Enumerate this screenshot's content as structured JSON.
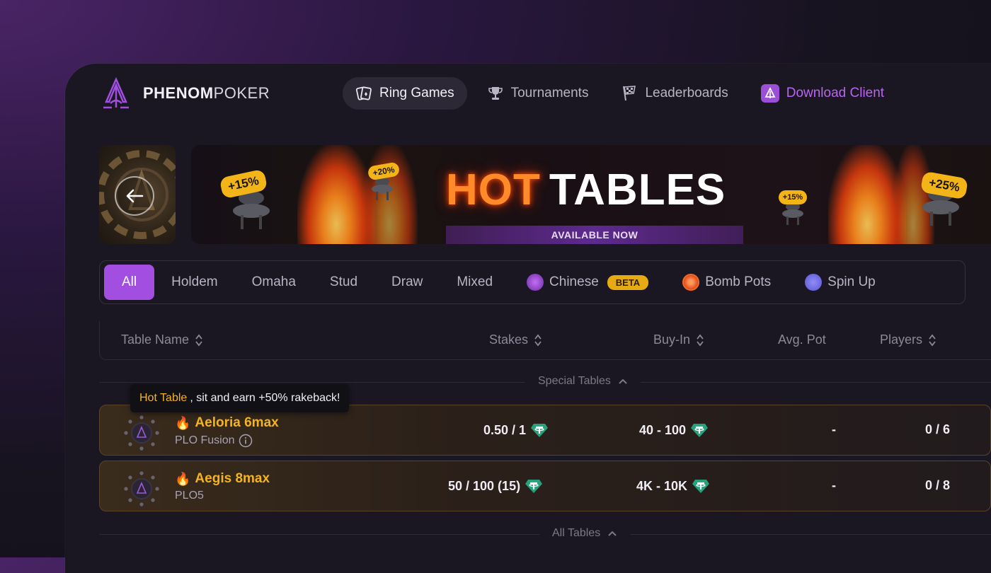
{
  "brand": {
    "name_bold": "PHENOM",
    "name_light": "POKER"
  },
  "nav": {
    "items": [
      {
        "label": "Ring Games",
        "icon": "cards-icon",
        "active": true
      },
      {
        "label": "Tournaments",
        "icon": "trophy-icon"
      },
      {
        "label": "Leaderboards",
        "icon": "flag-icon"
      },
      {
        "label": "Download Client",
        "icon": "download-client-icon"
      }
    ]
  },
  "banner": {
    "title_hot": "HOT",
    "title_tables": "TABLES",
    "subtitle": "AVAILABLE NOW",
    "badges": [
      "+15%",
      "+20%",
      "+15%",
      "+25%"
    ]
  },
  "filters": {
    "items": [
      "All",
      "Holdem",
      "Omaha",
      "Stud",
      "Draw",
      "Mixed",
      "Chinese",
      "Bomb Pots",
      "Spin Up"
    ],
    "beta_label": "BETA",
    "active": "All"
  },
  "table": {
    "headers": {
      "name": "Table Name",
      "stakes": "Stakes",
      "buyin": "Buy-In",
      "avgpot": "Avg. Pot",
      "players": "Players"
    },
    "special_section": "Special Tables",
    "all_section": "All Tables",
    "tooltip": {
      "highlight": "Hot Table",
      "rest": ", sit and earn +50% rakeback!"
    },
    "rows": [
      {
        "name": "Aeloria 6max",
        "variant": "PLO Fusion",
        "stakes": "0.50 / 1",
        "buyin": "40 - 100",
        "avgpot": "-",
        "players": "0 / 6"
      },
      {
        "name": "Aegis 8max",
        "variant": "PLO5",
        "stakes": "50 / 100 (15)",
        "buyin": "4K - 10K",
        "avgpot": "-",
        "players": "0 / 8"
      }
    ]
  },
  "colors": {
    "accent": "#a24ee0",
    "hot": "#f4b421",
    "tether": "#26a17b"
  }
}
